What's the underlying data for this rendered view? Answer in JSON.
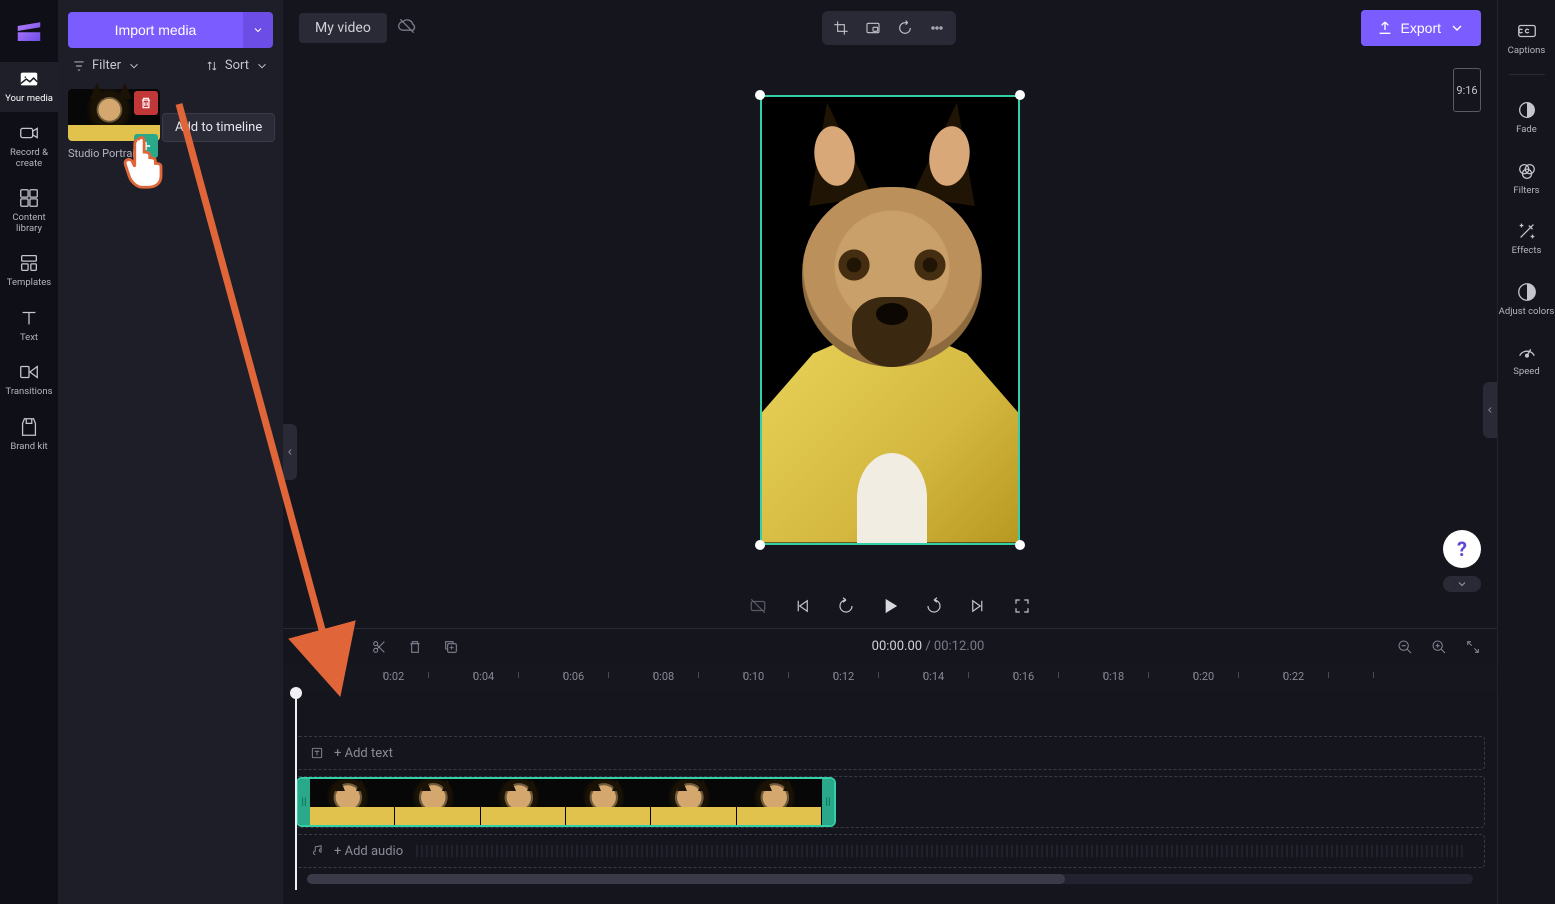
{
  "app": {
    "title": "My video",
    "export_label": "Export"
  },
  "import": {
    "label": "Import media"
  },
  "filter": {
    "label": "Filter"
  },
  "sort": {
    "label": "Sort"
  },
  "media_item": {
    "name": "Studio Portrai…",
    "tooltip": "Add to timeline"
  },
  "left_rail": {
    "your_media": "Your media",
    "record": "Record & create",
    "library": "Content library",
    "templates": "Templates",
    "text": "Text",
    "transitions": "Transitions",
    "brand": "Brand kit"
  },
  "right_rail": {
    "captions": "Captions",
    "fade": "Fade",
    "filters": "Filters",
    "effects": "Effects",
    "adjust": "Adjust colors",
    "speed": "Speed"
  },
  "aspect": {
    "label": "9:16"
  },
  "timecode": {
    "current": "00:00.00",
    "duration": "00:12.00"
  },
  "ruler": {
    "ticks": [
      "0:02",
      "0:04",
      "0:06",
      "0:08",
      "0:10",
      "0:12",
      "0:14",
      "0:16",
      "0:18",
      "0:20",
      "0:22"
    ]
  },
  "tracks": {
    "text_placeholder": "+ Add text",
    "audio_placeholder": "+ Add audio"
  },
  "help": {
    "glyph": "?"
  }
}
